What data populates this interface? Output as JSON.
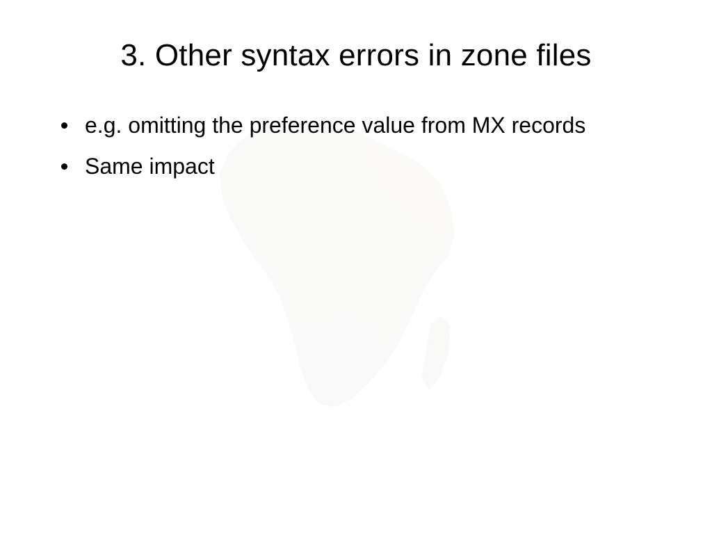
{
  "slide": {
    "title": "3. Other syntax errors in zone files",
    "bullets": [
      "e.g. omitting the preference value from MX records",
      "Same impact"
    ]
  }
}
